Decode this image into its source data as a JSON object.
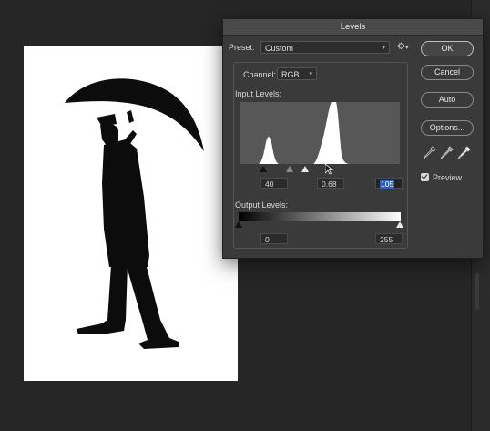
{
  "dialog": {
    "title": "Levels",
    "preset_label": "Preset:",
    "preset_value": "Custom",
    "channel_label": "Channel:",
    "channel_value": "RGB",
    "input_levels_label": "Input Levels:",
    "input_black": "40",
    "input_gamma": "0.68",
    "input_white": "105",
    "output_levels_label": "Output Levels:",
    "output_black": "0",
    "output_white": "255"
  },
  "buttons": {
    "ok": "OK",
    "cancel": "Cancel",
    "auto": "Auto",
    "options": "Options..."
  },
  "preview": {
    "label": "Preview",
    "checked": true
  },
  "icons": [
    "gear-icon",
    "black-eyedropper-icon",
    "gray-eyedropper-icon",
    "white-eyedropper-icon",
    "mouse-cursor-icon"
  ],
  "colors": {
    "dialog_bg": "#3a3a3a",
    "histogram_bg": "#575757",
    "selection": "#2e62b5"
  }
}
